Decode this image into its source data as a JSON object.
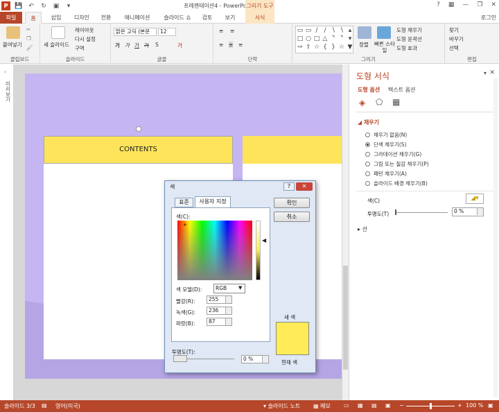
{
  "window": {
    "title": "프레젠테이션4 - PowerPoint",
    "context_tab_header": "그리기 도구",
    "login": "로그인"
  },
  "tabs": [
    "파일",
    "홈",
    "삽입",
    "디자인",
    "전환",
    "애니메이션",
    "슬라이드 쇼",
    "검토",
    "보기",
    "서식"
  ],
  "ribbon": {
    "clipboard": {
      "label": "클립보드",
      "paste": "붙여넣기"
    },
    "slides": {
      "label": "슬라이드",
      "new_slide": "새 슬라이드",
      "layout": "레이아웃",
      "reset": "다시 설정",
      "section": "구역"
    },
    "font": {
      "label": "글꼴",
      "font_name": "맑은 고딕 (본문",
      "font_size": "12"
    },
    "paragraph": {
      "label": "단락"
    },
    "drawing": {
      "label": "그리기",
      "arrange": "정렬",
      "quick_styles": "빠른 스타일",
      "shape_fill": "도형 채우기",
      "shape_outline": "도형 윤곽선",
      "shape_effects": "도형 효과"
    },
    "editing": {
      "label": "편집",
      "find": "찾기",
      "replace": "바꾸기",
      "select": "선택"
    }
  },
  "slide": {
    "contents_label": "CONTENTS"
  },
  "left_strip": {
    "label": "미리보기"
  },
  "format_pane": {
    "title": "도형 서식",
    "tab_shape": "도형 옵션",
    "tab_text": "텍스트 옵션",
    "fill_section": "채우기",
    "fill_options": [
      "채우기 없음(N)",
      "단색 채우기(S)",
      "그라데이션 채우기(G)",
      "그림 또는 질감 채우기(P)",
      "패턴 채우기(A)",
      "슬라이드 배경 채우기(B)"
    ],
    "selected_fill": 1,
    "color_label": "색(C)",
    "transparency_label": "투명도(T)",
    "transparency_value": "0 %",
    "line_section": "선"
  },
  "dialog": {
    "title": "색",
    "tab_standard": "표준",
    "tab_custom": "사용자 지정",
    "ok": "확인",
    "cancel": "취소",
    "colors_label": "색(C):",
    "color_model_label": "색 모델(D):",
    "color_model_value": "RGB",
    "red_label": "빨강(R):",
    "red_value": "255",
    "green_label": "녹색(G):",
    "green_value": "236",
    "blue_label": "파랑(B):",
    "blue_value": "87",
    "new_label": "새 색",
    "current_label": "현재 색",
    "transparency_label": "투명도(T):",
    "transparency_value": "0 %",
    "preview_color": "#ffec57"
  },
  "status": {
    "slide": "슬라이드 3/3",
    "language": "영어(미국)",
    "notes": "슬라이드 노트",
    "comments": "메모",
    "zoom": "100 %"
  },
  "colors": {
    "accent": "#b7472a",
    "slide_bg": "#c5b5f2",
    "label_fill": "#fde45a"
  }
}
